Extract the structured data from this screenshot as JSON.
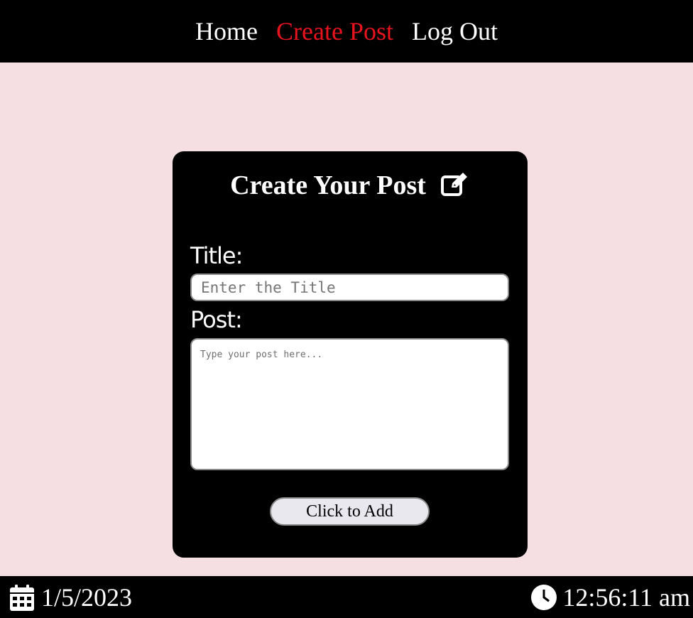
{
  "nav": {
    "items": [
      {
        "label": "Home",
        "active": false
      },
      {
        "label": "Create Post",
        "active": true
      },
      {
        "label": "Log Out",
        "active": false
      }
    ],
    "active_color": "#e8141d"
  },
  "form": {
    "heading": "Create Your Post",
    "heading_icon": "edit-icon",
    "title_label": "Title:",
    "title_placeholder": "Enter the Title",
    "title_value": "",
    "post_label": "Post:",
    "post_placeholder": "Type your post here...",
    "post_value": "",
    "submit_label": "Click to Add"
  },
  "footer": {
    "date_icon": "calendar-icon",
    "date": "1/5/2023",
    "time_icon": "clock-icon",
    "time": "12:56:11 am"
  },
  "colors": {
    "page_background": "#f5dfe2",
    "bar_background": "#000000",
    "card_background": "#000000"
  }
}
